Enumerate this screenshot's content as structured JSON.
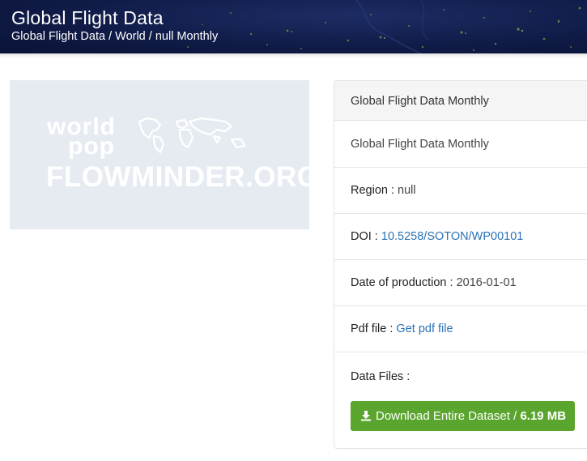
{
  "header": {
    "title": "Global Flight Data",
    "breadcrumb": "Global Flight Data / World / null Monthly"
  },
  "thumbnail": {
    "logo_world": "world",
    "logo_pop": "pop",
    "logo_flowminder": "FLOWMINDER.ORG"
  },
  "panel": {
    "heading": "Global Flight Data Monthly",
    "dataset_name": "Global Flight Data Monthly",
    "region_label": "Region : ",
    "region_value": "null",
    "doi_label": "DOI : ",
    "doi_value": "10.5258/SOTON/WP00101",
    "date_label": "Date of production : ",
    "date_value": "2016-01-01",
    "pdf_label": "Pdf file : ",
    "pdf_link": "Get pdf file",
    "files_label": "Data Files :",
    "download_label": "Download Entire Dataset / ",
    "download_size": "6.19 MB"
  },
  "colors": {
    "header_bg": "#101c48",
    "link": "#2a72b5",
    "download_button": "#5aa52e"
  },
  "icons": {
    "download": "download-icon"
  }
}
